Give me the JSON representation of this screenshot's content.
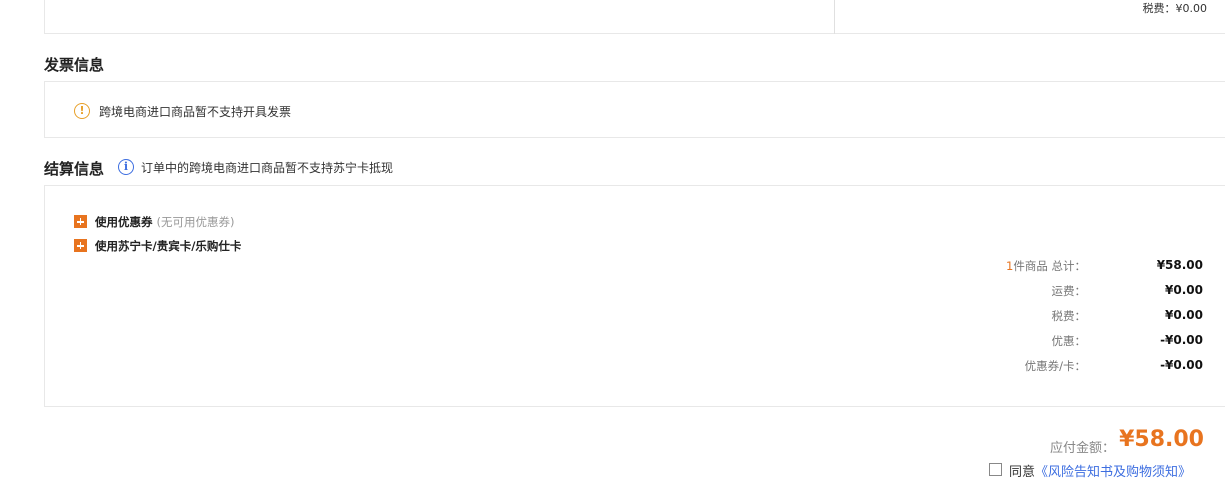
{
  "top": {
    "tax_line": "税费：¥0.00"
  },
  "invoice": {
    "title": "发票信息",
    "notice_icon": "warning-circle-icon",
    "notice": "跨境电商进口商品暂不支持开具发票"
  },
  "settlement": {
    "title": "结算信息",
    "info_icon": "info-circle-icon",
    "note": "订单中的跨境电商进口商品暂不支持苏宁卡抵现",
    "options": [
      {
        "label": "使用优惠券",
        "sub": "(无可用优惠券)"
      },
      {
        "label": "使用苏宁卡/贵宾卡/乐购仕卡",
        "sub": ""
      }
    ],
    "summary": {
      "count": "1",
      "goods_total_label": "件商品 总计：",
      "goods_total": "¥58.00",
      "shipping_label": "运费：",
      "shipping": "¥0.00",
      "tax_label": "税费：",
      "tax": "¥0.00",
      "discount_label": "优惠：",
      "discount": "-¥0.00",
      "coupon_label": "优惠券/卡：",
      "coupon": "-¥0.00"
    }
  },
  "payment": {
    "label": "应付金额：",
    "amount": "¥58.00",
    "agree_prefix": "同意",
    "agree_link": "《风险告知书及购物须知》"
  },
  "colors": {
    "accent": "#e8741f",
    "link": "#3d6ee0",
    "warning": "#e8a02a"
  }
}
